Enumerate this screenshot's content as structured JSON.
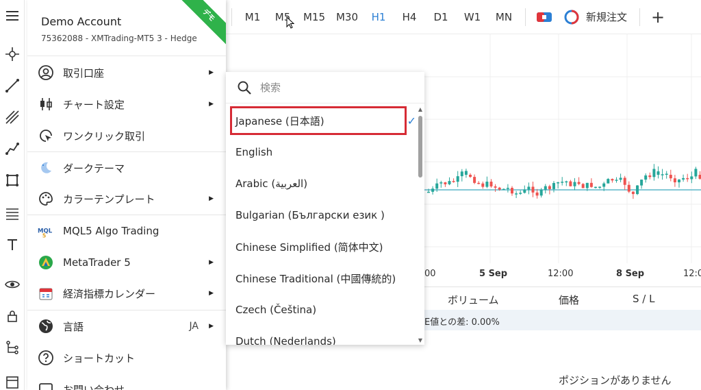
{
  "account": {
    "name": "Demo Account",
    "number": "75362088 - XMTrading-MT5 3 - Hedge",
    "ribbon": "デモ"
  },
  "menu": {
    "items": [
      {
        "label": "取引口座",
        "icon": "account-circle-icon",
        "has_submenu": true
      },
      {
        "label": "チャート設定",
        "icon": "candlestick-icon",
        "has_submenu": true
      },
      {
        "label": "ワンクリック取引",
        "icon": "cursor-click-icon",
        "has_submenu": false
      },
      {
        "label": "ダークテーマ",
        "icon": "moon-icon",
        "has_submenu": false
      },
      {
        "label": "カラーテンプレート",
        "icon": "palette-icon",
        "has_submenu": true
      },
      {
        "label": "MQL5 Algo Trading",
        "icon": "mql5-logo-icon",
        "has_submenu": false
      },
      {
        "label": "MetaTrader 5",
        "icon": "metatrader-logo-icon",
        "has_submenu": true
      },
      {
        "label": "経済指標カレンダー",
        "icon": "calendar-icon",
        "has_submenu": true
      },
      {
        "label": "言語",
        "icon": "globe-icon",
        "has_submenu": true,
        "code": "JA"
      },
      {
        "label": "ショートカット",
        "icon": "help-circle-icon",
        "has_submenu": false
      },
      {
        "label": "お問い合わせ",
        "icon": "chat-icon",
        "has_submenu": false
      }
    ]
  },
  "language_menu": {
    "search_placeholder": "検索",
    "items": [
      {
        "label": "Japanese (日本語)",
        "selected": true
      },
      {
        "label": "English"
      },
      {
        "label": "Arabic (العربية)"
      },
      {
        "label": "Bulgarian (Български език )"
      },
      {
        "label": "Chinese Simplified (简体中文)"
      },
      {
        "label": "Chinese Traditional (中國傳統的)"
      },
      {
        "label": "Czech (Čeština)"
      },
      {
        "label": "Dutch (Nederlands)"
      }
    ]
  },
  "toolbar": {
    "timeframes": [
      "M1",
      "M5",
      "M15",
      "M30",
      "H1",
      "H4",
      "D1",
      "W1",
      "MN"
    ],
    "active_timeframe": "H1",
    "new_order": "新規注文",
    "add": "+"
  },
  "chart": {
    "x_labels": [
      "00",
      "5 Sep",
      "12:00",
      "8 Sep",
      "12:0"
    ]
  },
  "table": {
    "headers": [
      "ボリューム",
      "価格",
      "S / L"
    ],
    "row_text": "E値との差: 0.00%",
    "empty_text": "ポジションがありません"
  },
  "colors": {
    "accent": "#2b7fd4",
    "bull": "#26a69a",
    "bear": "#ef5350",
    "highlight": "#d62b35",
    "ribbon": "#2fb24a"
  }
}
